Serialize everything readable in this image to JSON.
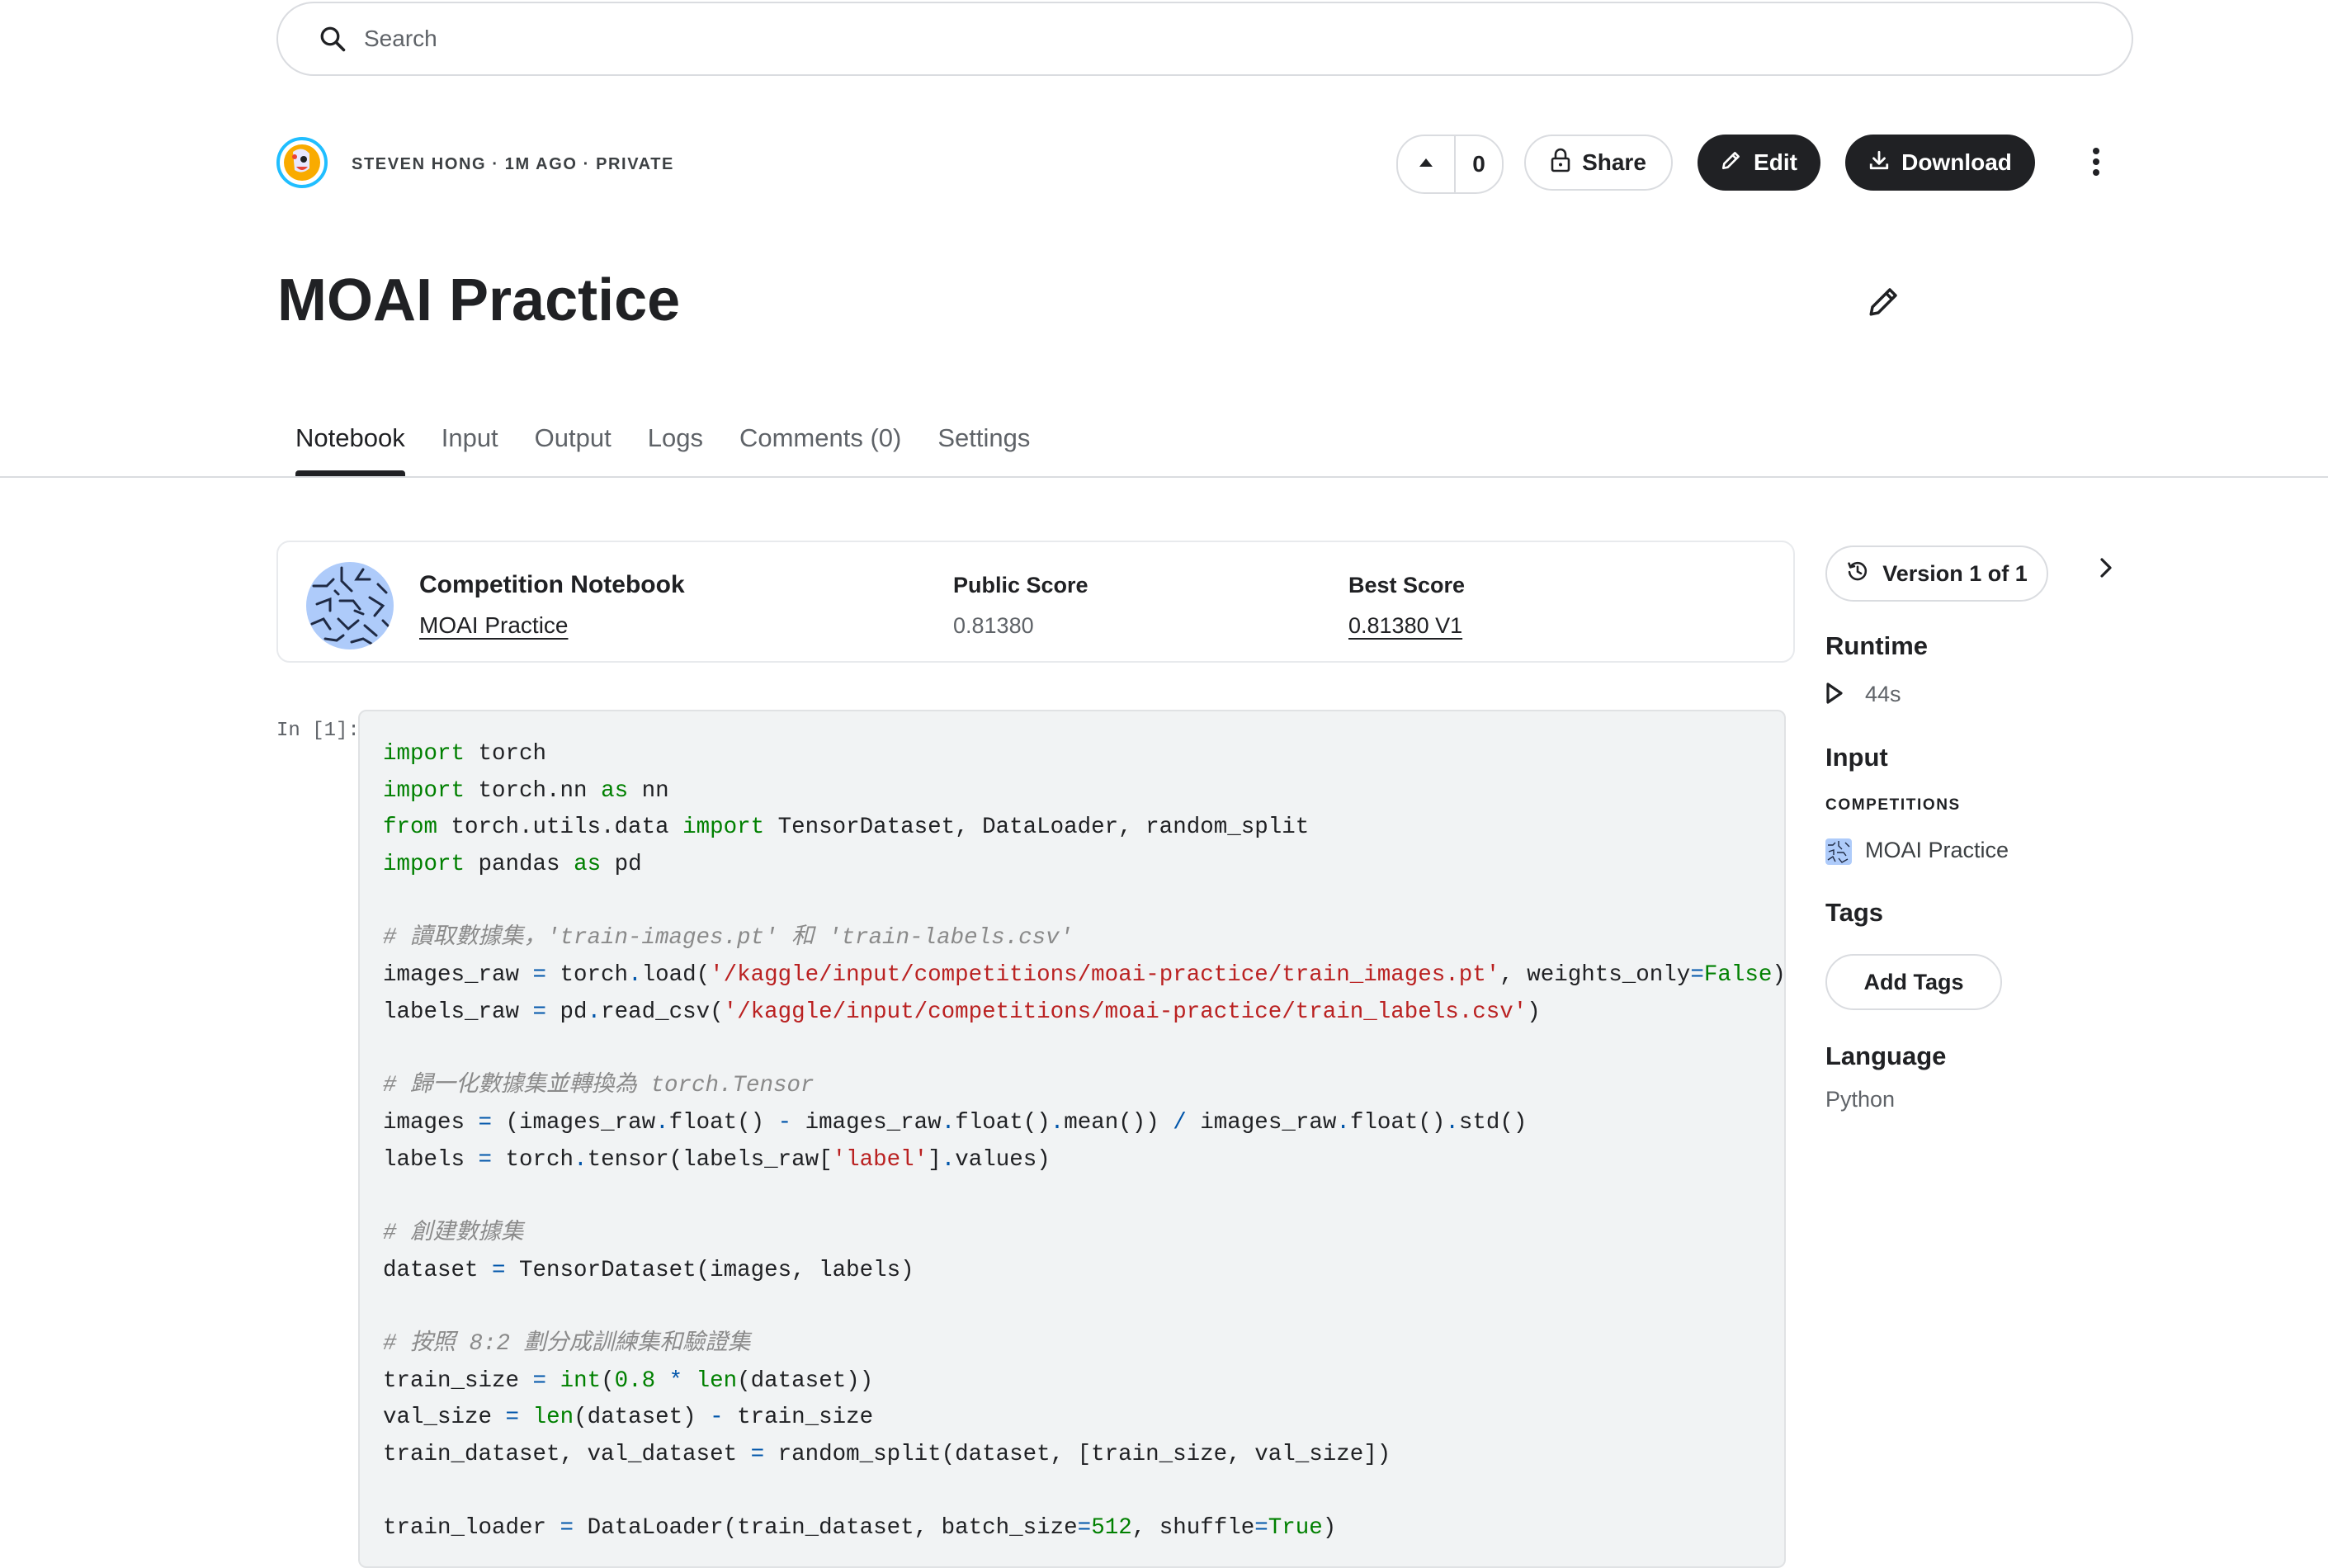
{
  "search": {
    "placeholder": "Search"
  },
  "header": {
    "meta": "STEVEN HONG · 1M AGO · PRIVATE",
    "vote_count": "0",
    "share_label": "Share",
    "edit_label": "Edit",
    "download_label": "Download"
  },
  "title": "MOAI Practice",
  "tabs": [
    {
      "label": "Notebook",
      "active": true
    },
    {
      "label": "Input"
    },
    {
      "label": "Output"
    },
    {
      "label": "Logs"
    },
    {
      "label": "Comments (0)"
    },
    {
      "label": "Settings"
    }
  ],
  "competition_card": {
    "title": "Competition Notebook",
    "link": "MOAI Practice",
    "public_score_label": "Public Score",
    "public_score": "0.81380",
    "best_score_label": "Best Score",
    "best_score": "0.81380 V1"
  },
  "cell": {
    "prompt": "In [1]:",
    "lines": [
      [
        [
          "kw",
          "import"
        ],
        [
          "t",
          " torch"
        ]
      ],
      [
        [
          "kw",
          "import"
        ],
        [
          "t",
          " torch.nn "
        ],
        [
          "kw",
          "as"
        ],
        [
          "t",
          " nn"
        ]
      ],
      [
        [
          "kw",
          "from"
        ],
        [
          "t",
          " torch.utils.data "
        ],
        [
          "kw",
          "import"
        ],
        [
          "t",
          " TensorDataset, DataLoader, random_split"
        ]
      ],
      [
        [
          "kw",
          "import"
        ],
        [
          "t",
          " pandas "
        ],
        [
          "kw",
          "as"
        ],
        [
          "t",
          " pd"
        ]
      ],
      [],
      [
        [
          "cm",
          "# 讀取數據集，'train-images.pt' 和 'train-labels.csv'"
        ]
      ],
      [
        [
          "t",
          "images_raw "
        ],
        [
          "op",
          "="
        ],
        [
          "t",
          " torch"
        ],
        [
          "op",
          "."
        ],
        [
          "t",
          "load("
        ],
        [
          "str",
          "'/kaggle/input/competitions/moai-practice/train_images.pt'"
        ],
        [
          "t",
          ", weights_only"
        ],
        [
          "op",
          "="
        ],
        [
          "boolv",
          "False"
        ],
        [
          "t",
          ")"
        ]
      ],
      [
        [
          "t",
          "labels_raw "
        ],
        [
          "op",
          "="
        ],
        [
          "t",
          " pd"
        ],
        [
          "op",
          "."
        ],
        [
          "t",
          "read_csv("
        ],
        [
          "str",
          "'/kaggle/input/competitions/moai-practice/train_labels.csv'"
        ],
        [
          "t",
          ")"
        ]
      ],
      [],
      [
        [
          "cm",
          "# 歸一化數據集並轉換為 torch.Tensor"
        ]
      ],
      [
        [
          "t",
          "images "
        ],
        [
          "op",
          "="
        ],
        [
          "t",
          " (images_raw"
        ],
        [
          "op",
          "."
        ],
        [
          "t",
          "float() "
        ],
        [
          "op",
          "-"
        ],
        [
          "t",
          " images_raw"
        ],
        [
          "op",
          "."
        ],
        [
          "t",
          "float()"
        ],
        [
          "op",
          "."
        ],
        [
          "t",
          "mean()) "
        ],
        [
          "op",
          "/"
        ],
        [
          "t",
          " images_raw"
        ],
        [
          "op",
          "."
        ],
        [
          "t",
          "float()"
        ],
        [
          "op",
          "."
        ],
        [
          "t",
          "std()"
        ]
      ],
      [
        [
          "t",
          "labels "
        ],
        [
          "op",
          "="
        ],
        [
          "t",
          " torch"
        ],
        [
          "op",
          "."
        ],
        [
          "t",
          "tensor(labels_raw["
        ],
        [
          "str",
          "'label'"
        ],
        [
          "t",
          "]"
        ],
        [
          "op",
          "."
        ],
        [
          "t",
          "values)"
        ]
      ],
      [],
      [
        [
          "cm",
          "# 創建數據集"
        ]
      ],
      [
        [
          "t",
          "dataset "
        ],
        [
          "op",
          "="
        ],
        [
          "t",
          " TensorDataset(images, labels)"
        ]
      ],
      [],
      [
        [
          "cm",
          "# 按照 8:2 劃分成訓練集和驗證集"
        ]
      ],
      [
        [
          "t",
          "train_size "
        ],
        [
          "op",
          "="
        ],
        [
          "t",
          " "
        ],
        [
          "bi",
          "int"
        ],
        [
          "t",
          "("
        ],
        [
          "num",
          "0.8"
        ],
        [
          "t",
          " "
        ],
        [
          "op",
          "*"
        ],
        [
          "t",
          " "
        ],
        [
          "bi",
          "len"
        ],
        [
          "t",
          "(dataset))"
        ]
      ],
      [
        [
          "t",
          "val_size "
        ],
        [
          "op",
          "="
        ],
        [
          "t",
          " "
        ],
        [
          "bi",
          "len"
        ],
        [
          "t",
          "(dataset) "
        ],
        [
          "op",
          "-"
        ],
        [
          "t",
          " train_size"
        ]
      ],
      [
        [
          "t",
          "train_dataset, val_dataset "
        ],
        [
          "op",
          "="
        ],
        [
          "t",
          " random_split(dataset, [train_size, val_size])"
        ]
      ],
      [],
      [
        [
          "t",
          "train_loader "
        ],
        [
          "op",
          "="
        ],
        [
          "t",
          " DataLoader(train_dataset, batch_size"
        ],
        [
          "op",
          "="
        ],
        [
          "num",
          "512"
        ],
        [
          "t",
          ", shuffle"
        ],
        [
          "op",
          "="
        ],
        [
          "boolv",
          "True"
        ],
        [
          "t",
          ")"
        ]
      ]
    ]
  },
  "sidebar": {
    "version_label": "Version 1 of 1",
    "runtime_heading": "Runtime",
    "runtime_value": "44s",
    "input_heading": "Input",
    "input_caption": "COMPETITIONS",
    "input_item": "MOAI Practice",
    "tags_heading": "Tags",
    "add_tags_label": "Add Tags",
    "language_heading": "Language",
    "language_value": "Python"
  },
  "icons": {
    "search": "search-icon",
    "upvote": "triangle-up-icon",
    "share": "lock-icon",
    "edit": "pencil-icon",
    "download": "download-icon",
    "more": "more-vert-icon",
    "version": "history-icon",
    "next": "chevron-right-icon",
    "runtime": "play-icon"
  },
  "colors": {
    "primary_button": "#202124",
    "border": "#dadce0",
    "code_bg": "#f1f3f4"
  }
}
